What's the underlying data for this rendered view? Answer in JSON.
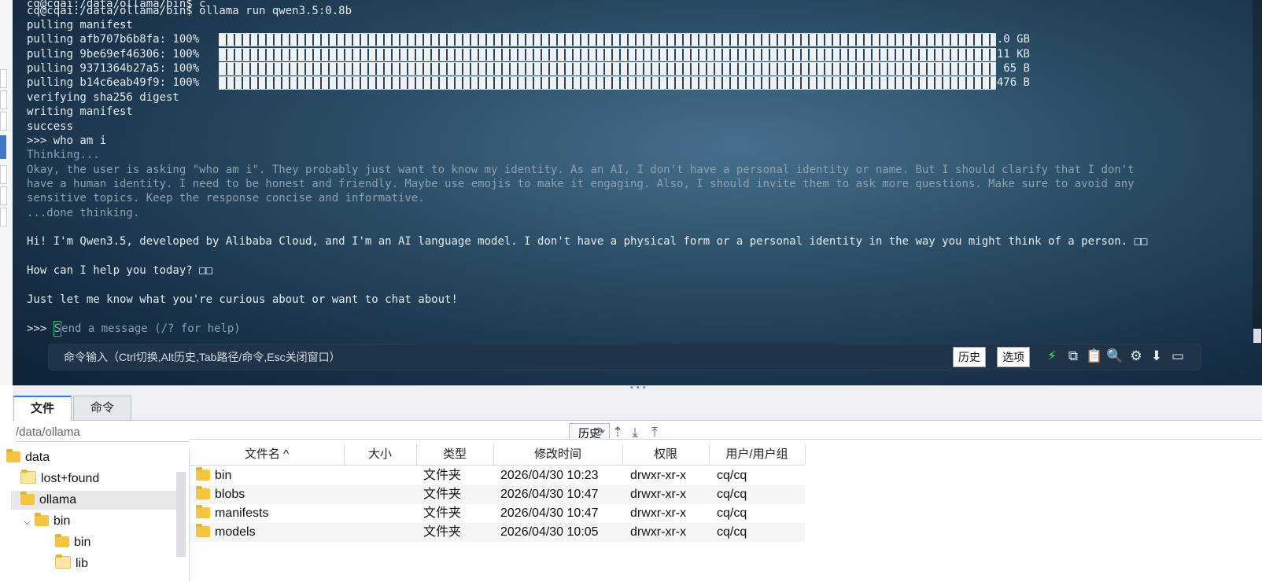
{
  "terminal": {
    "lines": [
      {
        "text": "cq@cqai:/data/ollama/bin$ ollama run qwen3.5:0.8b",
        "style": "normal"
      },
      {
        "text": "pulling manifest",
        "style": "normal"
      },
      {
        "text": "pulling afb707b6b8fa: 100%",
        "style": "normal"
      },
      {
        "text": "pulling 9be69ef46306: 100%",
        "style": "normal"
      },
      {
        "text": "pulling 9371364b27a5: 100%",
        "style": "normal"
      },
      {
        "text": "pulling b14c6eab49f9: 100%",
        "style": "normal"
      },
      {
        "text": "verifying sha256 digest",
        "style": "normal"
      },
      {
        "text": "writing manifest",
        "style": "normal"
      },
      {
        "text": "success",
        "style": "normal"
      },
      {
        "text": ">>> who am i",
        "style": "normal"
      },
      {
        "text": "Thinking...",
        "style": "dim"
      },
      {
        "text": "Okay, the user is asking \"who am i\". They probably just want to know my identity. As an AI, I don't have a personal identity or name. But I should clarify that I don't",
        "style": "dim"
      },
      {
        "text": "have a human identity. I need to be honest and friendly. Maybe use emojis to make it engaging. Also, I should invite them to ask more questions. Make sure to avoid any",
        "style": "dim"
      },
      {
        "text": "sensitive topics. Keep the response concise and informative.",
        "style": "dim"
      },
      {
        "text": "...done thinking.",
        "style": "dim"
      },
      {
        "text": "",
        "style": "normal"
      },
      {
        "text": "Hi! I'm Qwen3.5, developed by Alibaba Cloud, and I'm an AI language model. I don't have a physical form or a personal identity in the way you might think of a person. □□",
        "style": "normal"
      },
      {
        "text": "",
        "style": "normal"
      },
      {
        "text": "How can I help you today? □□",
        "style": "normal"
      },
      {
        "text": "",
        "style": "normal"
      },
      {
        "text": "Just let me know what you're curious about or want to chat about!",
        "style": "normal"
      }
    ],
    "pull_sizes": [
      "1.0 GB",
      "11 KB",
      "65 B",
      "476 B"
    ],
    "pull_progress": [
      1.0,
      1.0,
      1.0,
      1.0
    ],
    "prompt_prefix": ">>> ",
    "prompt_cursor_char": "S",
    "prompt_placeholder_rest": "end a message (/? for help)"
  },
  "cmdbar": {
    "hint": "命令输入（Ctrl切换,Alt历史,Tab路径/命令,Esc关闭窗口）",
    "history_label": "历史",
    "options_label": "选项",
    "icons": [
      "lightning-icon",
      "copy-icon",
      "paste-icon",
      "search-icon",
      "gear-icon",
      "arrow-down-icon",
      "maximize-icon"
    ]
  },
  "tabs": [
    {
      "label": "文件",
      "active": true
    },
    {
      "label": "命令",
      "active": false
    }
  ],
  "pathbar": {
    "path": "/data/ollama",
    "history_label": "历史",
    "icons": [
      "refresh-icon",
      "up-icon",
      "download-icon",
      "upload-icon"
    ]
  },
  "tree": [
    {
      "label": "data",
      "level": 0,
      "selected": false
    },
    {
      "label": "lost+found",
      "level": 1,
      "selected": false
    },
    {
      "label": "ollama",
      "level": 1,
      "selected": true
    },
    {
      "label": "bin",
      "level": 2,
      "selected": false,
      "expanded": true
    },
    {
      "label": "bin",
      "level": 3,
      "selected": false
    },
    {
      "label": "lib",
      "level": 3,
      "selected": false
    }
  ],
  "filelist": {
    "columns": [
      "文件名 ^",
      "大小",
      "类型",
      "修改时间",
      "权限",
      "用户/用户组"
    ],
    "rows": [
      {
        "name": "bin",
        "size": "",
        "type": "文件夹",
        "mtime": "2026/04/30 10:23",
        "perm": "drwxr-xr-x",
        "owner": "cq/cq"
      },
      {
        "name": "blobs",
        "size": "",
        "type": "文件夹",
        "mtime": "2026/04/30 10:47",
        "perm": "drwxr-xr-x",
        "owner": "cq/cq"
      },
      {
        "name": "manifests",
        "size": "",
        "type": "文件夹",
        "mtime": "2026/04/30 10:47",
        "perm": "drwxr-xr-x",
        "owner": "cq/cq"
      },
      {
        "name": "models",
        "size": "",
        "type": "文件夹",
        "mtime": "2026/04/30 10:05",
        "perm": "drwxr-xr-x",
        "owner": "cq/cq"
      }
    ]
  }
}
